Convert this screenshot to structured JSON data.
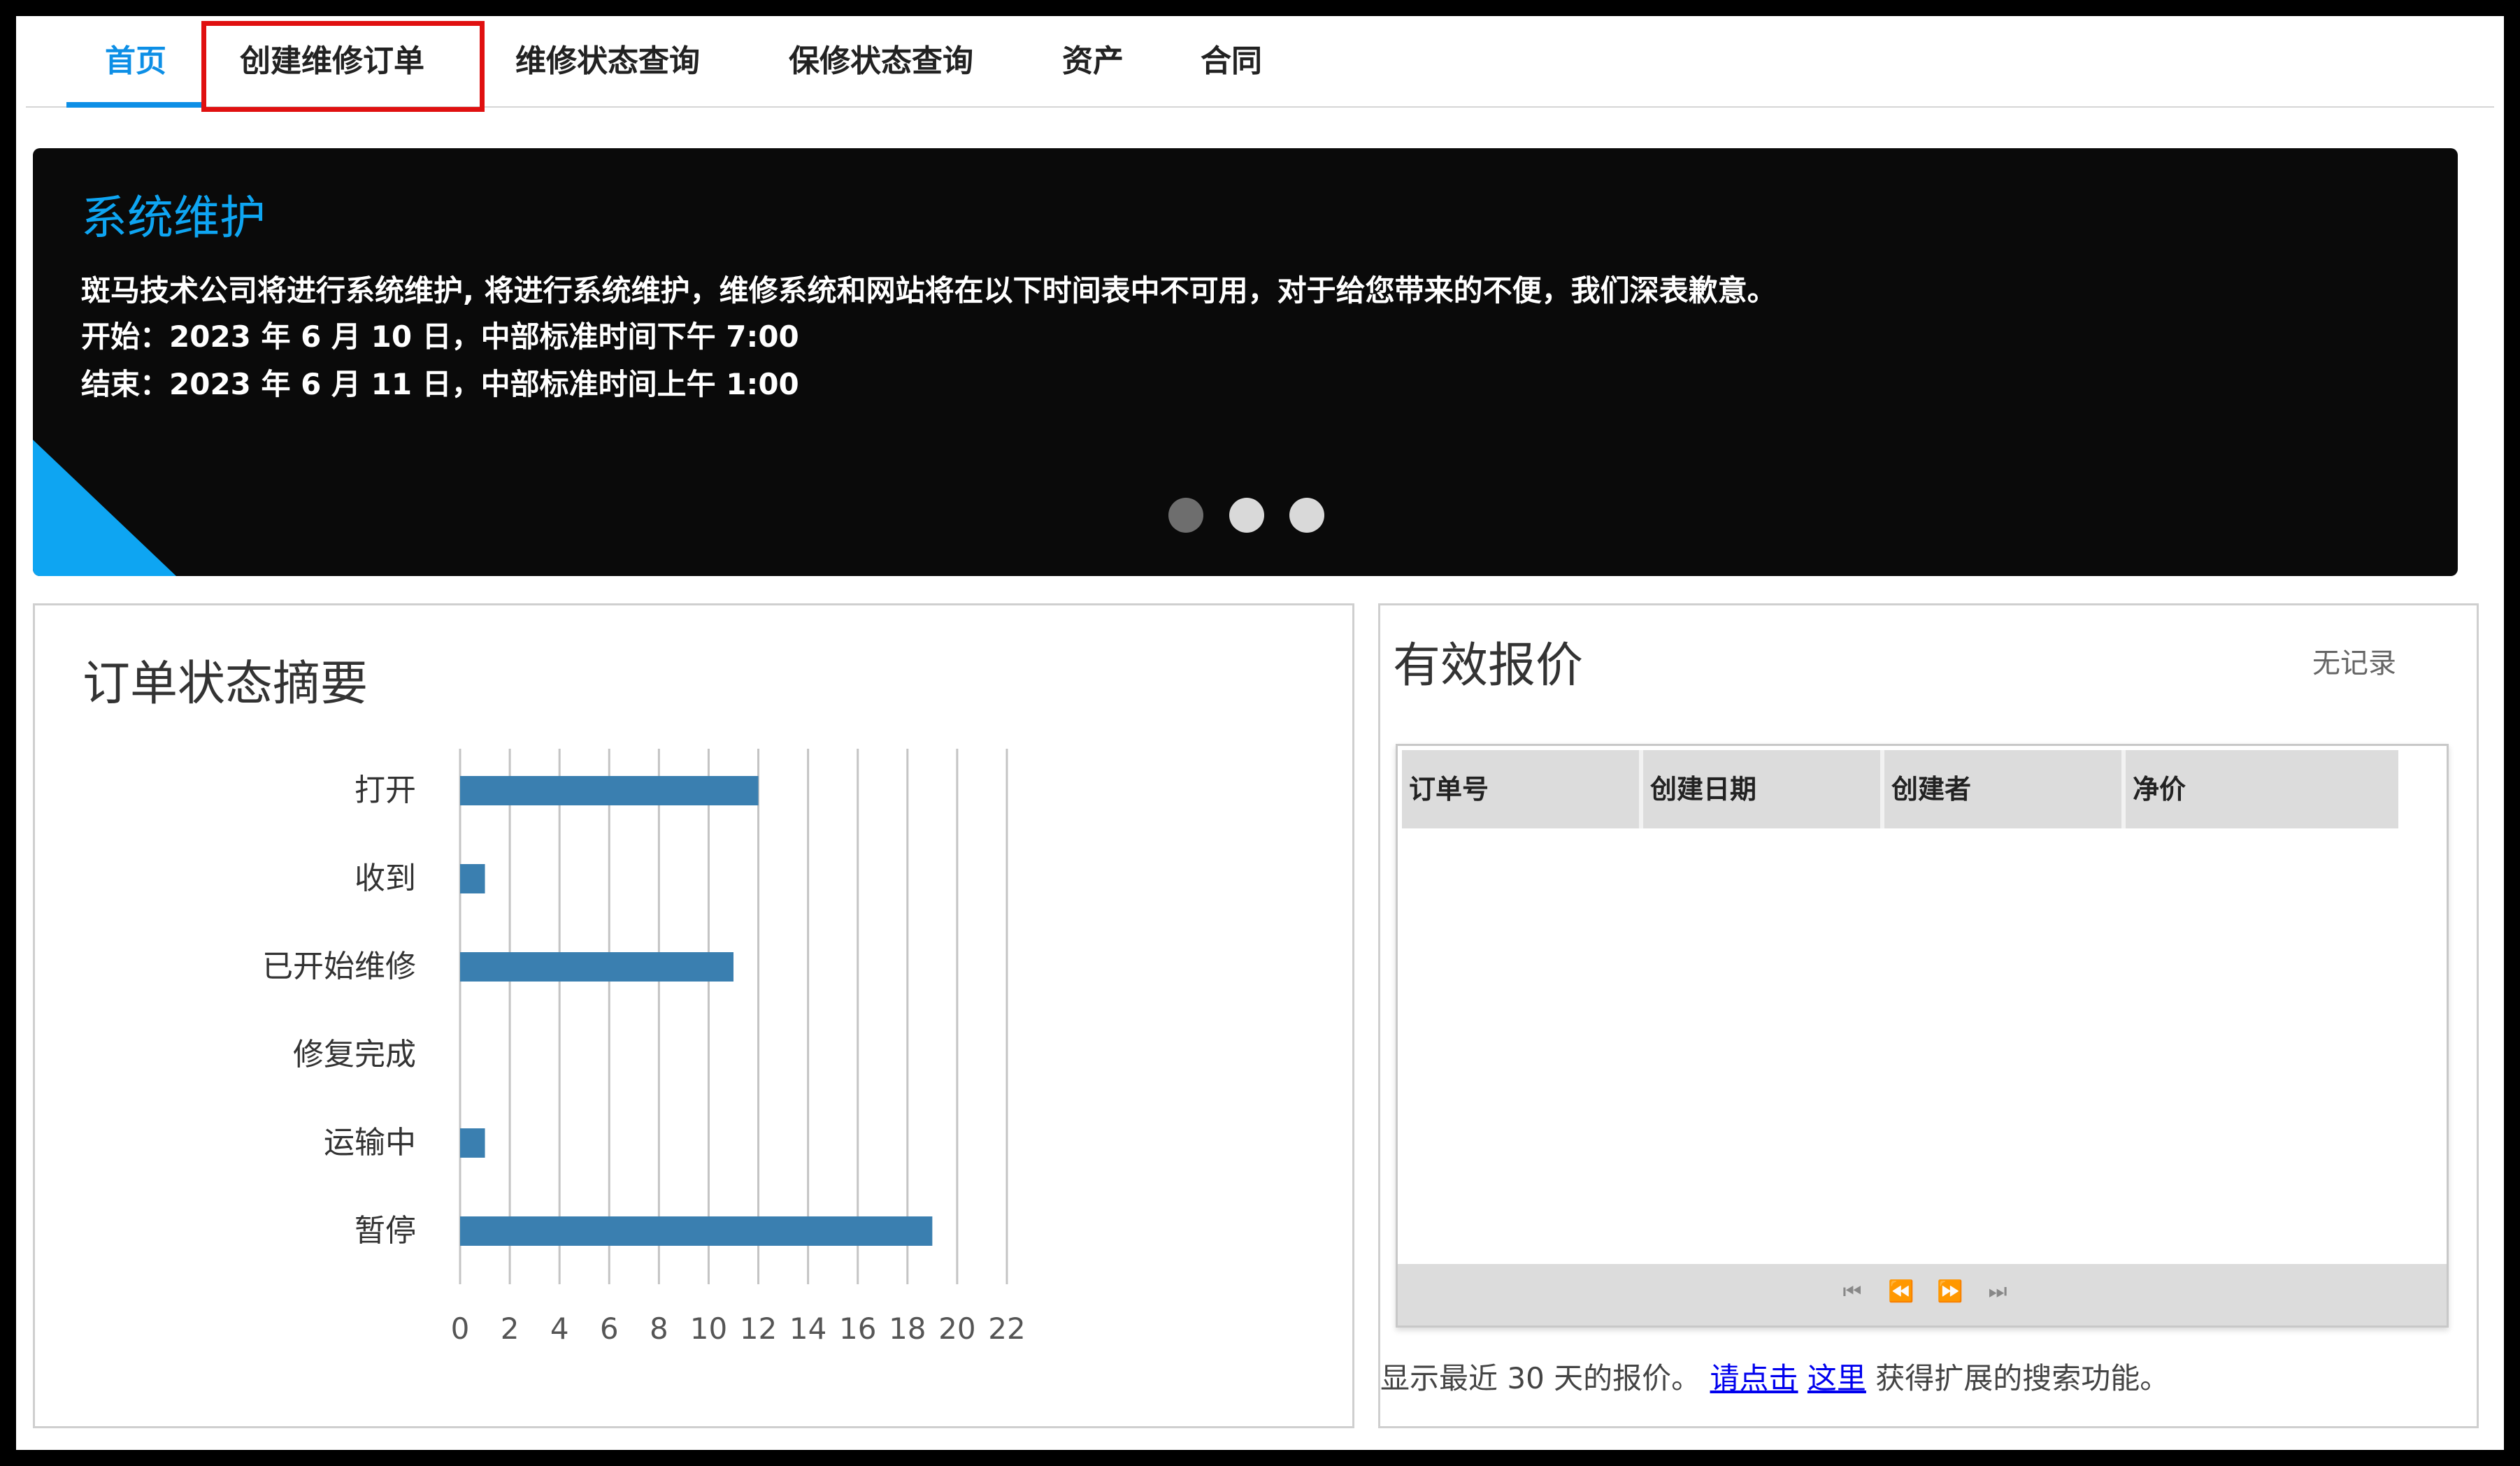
{
  "nav": {
    "tabs": [
      {
        "label": "首页",
        "active": true
      },
      {
        "label": "创建维修订单",
        "active": false,
        "highlighted": true
      },
      {
        "label": "维修状态查询",
        "active": false
      },
      {
        "label": "保修状态查询",
        "active": false
      },
      {
        "label": "资产",
        "active": false
      },
      {
        "label": "合同",
        "active": false
      }
    ]
  },
  "banner": {
    "title": "系统维护",
    "lines": [
      "斑马技术公司将进行系统维护, 将进行系统维护，维修系统和网站将在以下时间表中不可用，对于给您带来的不便，我们深表歉意。",
      "开始：2023 年 6 月 10 日，中部标准时间下午 7:00",
      "结束：2023 年 6 月 11 日，中部标准时间上午 1:00"
    ],
    "carousel_dots": 3
  },
  "orders_panel": {
    "title": "订单状态摘要"
  },
  "chart_data": {
    "type": "bar",
    "orientation": "horizontal",
    "title": "订单状态摘要",
    "categories": [
      "打开",
      "收到",
      "已开始维修",
      "修复完成",
      "运输中",
      "暂停"
    ],
    "values": [
      12,
      1,
      11,
      0,
      1,
      19
    ],
    "xticks": [
      "0",
      "2",
      "4",
      "6",
      "8",
      "10",
      "12",
      "14",
      "16",
      "18",
      "20",
      "22"
    ],
    "xlim": [
      0,
      22
    ],
    "grid": true,
    "color": "#3a7fb0"
  },
  "quotes_panel": {
    "title": "有效报价",
    "no_records": "无记录",
    "columns": [
      "订单号",
      "创建日期",
      "创建者",
      "净价"
    ],
    "rows": [],
    "pager": [
      "⏮",
      "⏪",
      "⏩",
      "⏭"
    ],
    "note_prefix": "显示最近 30 天的报价。",
    "note_link1": "请点击",
    "note_link2": "这里",
    "note_suffix": "获得扩展的搜索功能。"
  }
}
